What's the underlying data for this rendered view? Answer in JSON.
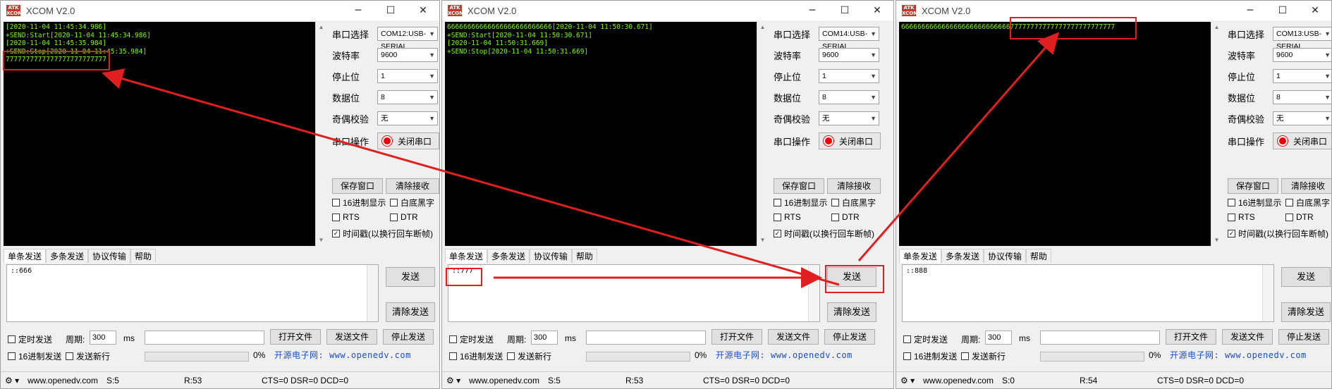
{
  "windows": [
    {
      "title": "XCOM V2.0",
      "logo": "ATK XCOM",
      "terminal": "[2020-11-04 11:45:34.986]\n+SEND:Start[2020-11-04 11:45:34.986]\n[2020-11-04 11:45:35.984]\n+SEND:Stop[2020-11-04 11:45:35.984]\n7777777777777777777777777",
      "port_label": "串口选择",
      "port_value": "COM12:USB-SERIAL",
      "baud_label": "波特率",
      "baud_value": "9600",
      "stopbit_label": "停止位",
      "stopbit_value": "1",
      "databit_label": "数据位",
      "databit_value": "8",
      "parity_label": "奇偶校验",
      "parity_value": "无",
      "op_label": "串口操作",
      "op_button": "关闭串口",
      "save_window": "保存窗口",
      "clear_receive": "清除接收",
      "hex_display": "16进制显示",
      "white_bg": "白底黑字",
      "rts": "RTS",
      "dtr": "DTR",
      "timestamp": "时间戳(以换行回车断帧)",
      "tabs": [
        "单条发送",
        "多条发送",
        "协议传输",
        "帮助"
      ],
      "send_text": "::666",
      "send_button": "发送",
      "clear_send": "清除发送",
      "timed_send": "定时发送",
      "period_label": "周期:",
      "period_value": "300",
      "period_unit": "ms",
      "open_file": "打开文件",
      "send_file": "发送文件",
      "stop_send": "停止发送",
      "hex_send": "16进制发送",
      "send_newline": "发送新行",
      "progress": "0%",
      "site": "开源电子网: www.openedv.com",
      "status_url": "www.openedv.com",
      "status_s": "S:5",
      "status_r": "R:53",
      "status_lines": "CTS=0 DSR=0 DCD=0"
    },
    {
      "title": "XCOM V2.0",
      "logo": "ATK XCOM",
      "terminal": "66666666666666666666666666[2020-11-04 11:50:30.671]\n+SEND:Start[2020-11-04 11:50:30.671]\n[2020-11-04 11:50:31.669]\n+SEND:Stop[2020-11-04 11:50:31.669]",
      "port_label": "串口选择",
      "port_value": "COM14:USB-SERIAL",
      "baud_label": "波特率",
      "baud_value": "9600",
      "stopbit_label": "停止位",
      "stopbit_value": "1",
      "databit_label": "数据位",
      "databit_value": "8",
      "parity_label": "奇偶校验",
      "parity_value": "无",
      "op_label": "串口操作",
      "op_button": "关闭串口",
      "save_window": "保存窗口",
      "clear_receive": "清除接收",
      "hex_display": "16进制显示",
      "white_bg": "白底黑字",
      "rts": "RTS",
      "dtr": "DTR",
      "timestamp": "时间戳(以换行回车断帧)",
      "tabs": [
        "单条发送",
        "多条发送",
        "协议传输",
        "帮助"
      ],
      "send_text": "::777",
      "send_button": "发送",
      "clear_send": "清除发送",
      "timed_send": "定时发送",
      "period_label": "周期:",
      "period_value": "300",
      "period_unit": "ms",
      "open_file": "打开文件",
      "send_file": "发送文件",
      "stop_send": "停止发送",
      "hex_send": "16进制发送",
      "send_newline": "发送新行",
      "progress": "0%",
      "site": "开源电子网: www.openedv.com",
      "status_url": "www.openedv.com",
      "status_s": "S:5",
      "status_r": "R:53",
      "status_lines": "CTS=0 DSR=0 DCD=0"
    },
    {
      "title": "XCOM V2.0",
      "logo": "ATK XCOM",
      "terminal": "66666666666666666666666666677777777777777777777777777",
      "port_label": "串口选择",
      "port_value": "COM13:USB-SERIAL",
      "baud_label": "波特率",
      "baud_value": "9600",
      "stopbit_label": "停止位",
      "stopbit_value": "1",
      "databit_label": "数据位",
      "databit_value": "8",
      "parity_label": "奇偶校验",
      "parity_value": "无",
      "op_label": "串口操作",
      "op_button": "关闭串口",
      "save_window": "保存窗口",
      "clear_receive": "清除接收",
      "hex_display": "16进制显示",
      "white_bg": "白底黑字",
      "rts": "RTS",
      "dtr": "DTR",
      "timestamp": "时间戳(以换行回车断帧)",
      "tabs": [
        "单条发送",
        "多条发送",
        "协议传输",
        "帮助"
      ],
      "send_text": "::888",
      "send_button": "发送",
      "clear_send": "清除发送",
      "timed_send": "定时发送",
      "period_label": "周期:",
      "period_value": "300",
      "period_unit": "ms",
      "open_file": "打开文件",
      "send_file": "发送文件",
      "stop_send": "停止发送",
      "hex_send": "16进制发送",
      "send_newline": "发送新行",
      "progress": "0%",
      "site": "开源电子网: www.openedv.com",
      "status_url": "www.openedv.com",
      "status_s": "S:0",
      "status_r": "R:54",
      "status_lines": "CTS=0 DSR=0 DCD=0"
    }
  ],
  "colors": {
    "terminal_bg": "#000000",
    "terminal_text": "#7cfc00",
    "annotation": "#e02020",
    "site_link": "#1a4cd8"
  }
}
